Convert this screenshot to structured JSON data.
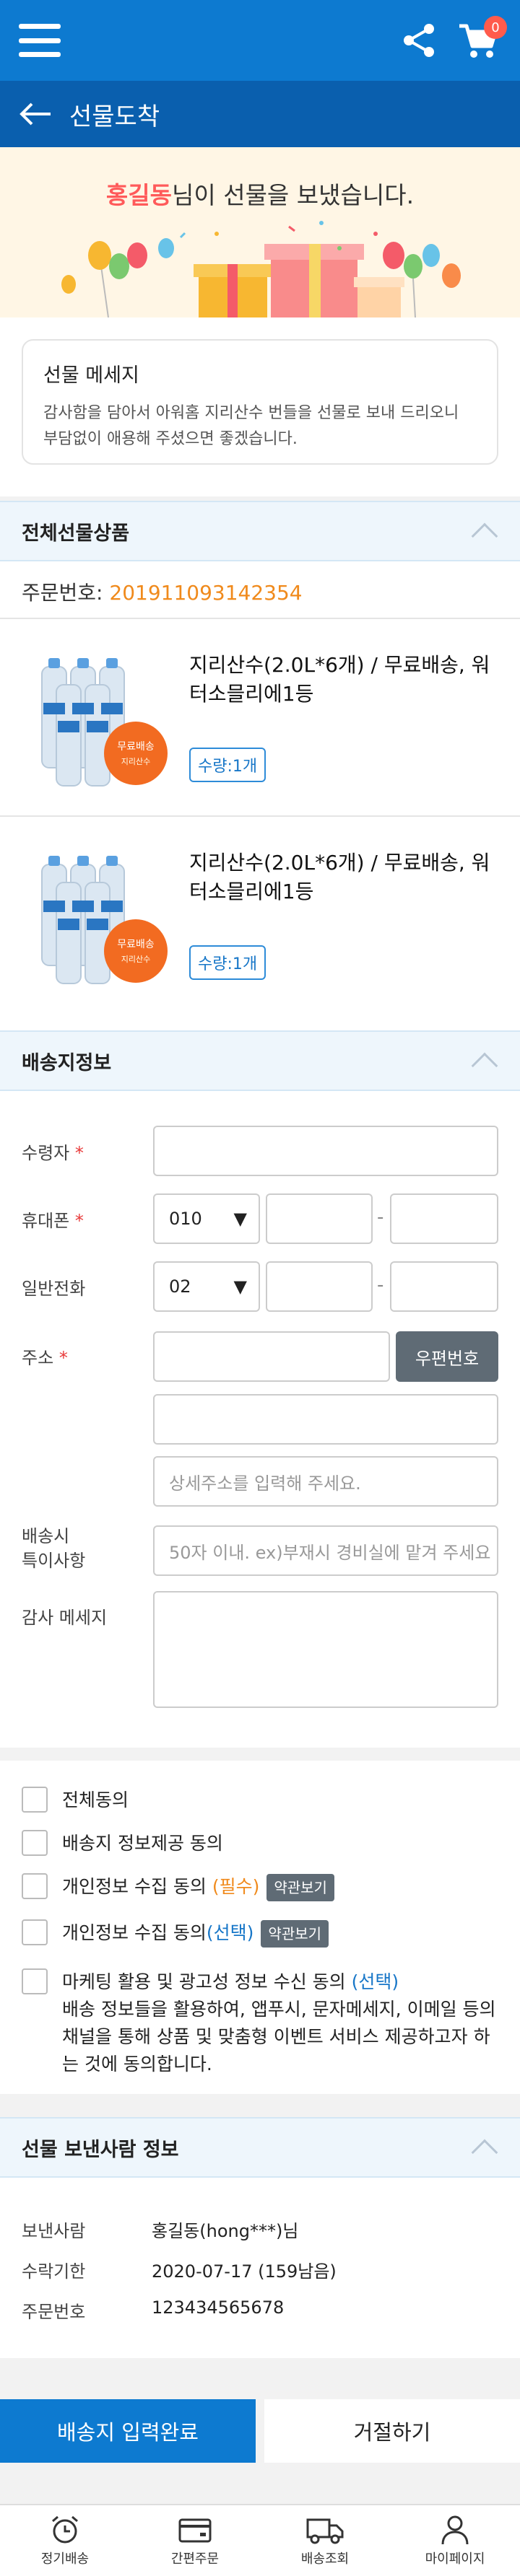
{
  "header": {
    "cart_count": "0"
  },
  "titlebar": {
    "title": "선물도착"
  },
  "hero": {
    "sender": "홍길동",
    "message_suffix": "님이 선물을 보냈습니다."
  },
  "gift_message": {
    "title": "선물 메세지",
    "body": "감사함을 담아서 아워홈 지리산수 번들을 선물로 보내 드리오니 부담없이 애용해 주셨으면 좋겠습니다."
  },
  "products_section": {
    "title": "전체선물상품",
    "order_label": "주문번호: ",
    "order_number": "201911093142354",
    "items": [
      {
        "name": "지리산수(2.0L*6개) / 무료배송, 워터소믈리에1등",
        "qty": "수량:1개",
        "img_badge": "무료배송",
        "img_sub": "지리산수"
      },
      {
        "name": "지리산수(2.0L*6개) / 무료배송, 워터소믈리에1등",
        "qty": "수량:1개",
        "img_badge": "무료배송",
        "img_sub": "지리산수"
      }
    ]
  },
  "shipping": {
    "title": "배송지정보",
    "receiver_label": "수령자",
    "phone_label": "휴대폰",
    "phone_prefix": "010",
    "tel_label": "일반전화",
    "tel_prefix": "02",
    "address_label": "주소",
    "zip_button": "우편번호",
    "detail_placeholder": "상세주소를 입력해 주세요.",
    "note_label_1": "배송시",
    "note_label_2": "특이사항",
    "note_placeholder": "50자 이내. ex)부재시 경비실에 맡겨 주세요",
    "thanks_label": "감사 메세지",
    "required_mark": "*",
    "dash": "-"
  },
  "agreements": {
    "all": "전체동의",
    "provide": "배송지 정보제공 동의",
    "collect_req_text": "개인정보 수집 동의 ",
    "collect_req_tag": "(필수)",
    "collect_opt_text": "개인정보 수집 동의",
    "collect_opt_tag": "(선택)",
    "terms_button": "약관보기",
    "marketing_text": "마케팅 활용 및 광고성 정보 수신 동의 ",
    "marketing_tag": "(선택)",
    "marketing_desc": "배송 정보들을 활용하여, 앱푸시, 문자메세지, 이메일 등의 채널을 통해 상품 및 맞춤형 이벤트 서비스 제공하고자 하는 것에 동의합니다."
  },
  "sender_section": {
    "title": "선물 보낸사람 정보",
    "rows": [
      {
        "label": "보낸사람",
        "value": "홍길동(hong***)님"
      },
      {
        "label": "수락기한",
        "value": "2020-07-17 (159남음)"
      },
      {
        "label": "주문번호",
        "value": "123434565678"
      }
    ]
  },
  "actions": {
    "submit": "배송지 입력완료",
    "reject": "거절하기"
  },
  "tabbar": {
    "items": [
      "정기배송",
      "간편주문",
      "배송조회",
      "마이페이지"
    ]
  },
  "colors": {
    "primary": "#0d7ad0",
    "dark_primary": "#0a5fae",
    "accent_orange": "#f08a1c",
    "accent_red": "#ff5a5a"
  }
}
